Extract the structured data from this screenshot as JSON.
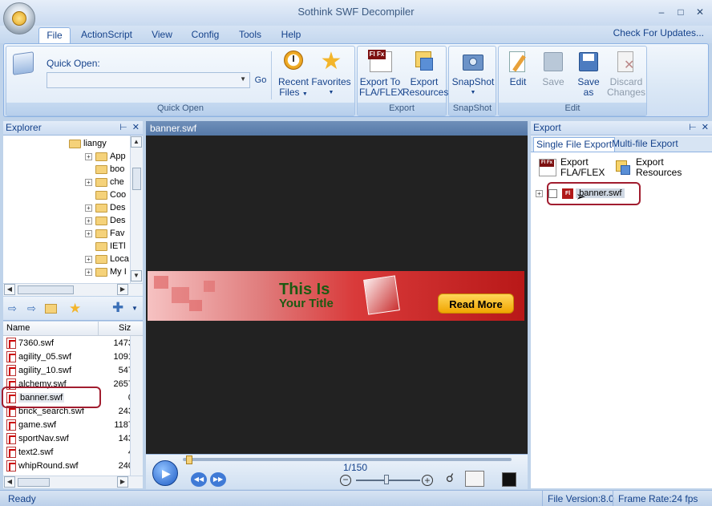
{
  "window": {
    "title": "Sothink SWF Decompiler"
  },
  "menu_tabs": [
    "File",
    "ActionScript",
    "View",
    "Config",
    "Tools",
    "Help"
  ],
  "check_updates": "Check For Updates...",
  "ribbon": {
    "quick_open": {
      "label": "Quick Open:",
      "go": "Go",
      "caption": "Quick Open"
    },
    "recent": {
      "line1": "Recent",
      "line2": "Files"
    },
    "favorites": "Favorites",
    "export_to": {
      "line1": "Export To",
      "line2": "FLA/FLEX"
    },
    "export_res": {
      "line1": "Export",
      "line2": "Resources"
    },
    "export_caption": "Export",
    "snapshot": "SnapShot",
    "snapshot_caption": "SnapShot",
    "edit": "Edit",
    "save": "Save",
    "save_as": {
      "line1": "Save",
      "line2": "as"
    },
    "discard": {
      "line1": "Discard",
      "line2": "Changes"
    },
    "edit_caption": "Edit"
  },
  "explorer": {
    "title": "Explorer",
    "tree": [
      {
        "label": "liangy",
        "expandable": false
      },
      {
        "label": "App",
        "expandable": true
      },
      {
        "label": "boo",
        "expandable": false
      },
      {
        "label": "che",
        "expandable": true
      },
      {
        "label": "Coo",
        "expandable": false
      },
      {
        "label": "Des",
        "expandable": true
      },
      {
        "label": "Des",
        "expandable": true
      },
      {
        "label": "Fav",
        "expandable": true
      },
      {
        "label": "IETl",
        "expandable": false
      },
      {
        "label": "Loca",
        "expandable": true
      },
      {
        "label": "My I",
        "expandable": true
      }
    ],
    "columns": {
      "name": "Name",
      "size": "Siz"
    },
    "files": [
      {
        "name": "7360.swf",
        "size": "1473"
      },
      {
        "name": "agility_05.swf",
        "size": "1091"
      },
      {
        "name": "agility_10.swf",
        "size": "547"
      },
      {
        "name": "alchemy.swf",
        "size": "2657"
      },
      {
        "name": "banner.swf",
        "size": "0"
      },
      {
        "name": "brick_search.swf",
        "size": "243"
      },
      {
        "name": "game.swf",
        "size": "1187"
      },
      {
        "name": "sportNav.swf",
        "size": "143"
      },
      {
        "name": "text2.swf",
        "size": "4"
      },
      {
        "name": "whipRound.swf",
        "size": "240"
      }
    ]
  },
  "preview": {
    "tab": "banner.swf",
    "banner": {
      "line1": "This Is",
      "line2": "Your Title",
      "button": "Read More"
    },
    "frame": "1/150",
    "progress": 0.0
  },
  "export": {
    "title": "Export",
    "tabs": [
      "Single File Export",
      "Multi-file Export"
    ],
    "btn_fla": {
      "line1": "Export",
      "line2": "FLA/FLEX"
    },
    "btn_res": {
      "line1": "Export",
      "line2": "Resources"
    },
    "item": "banner.swf"
  },
  "status": {
    "left": "Ready",
    "version": "File Version:8.0",
    "framerate": "Frame Rate:24 fps"
  }
}
